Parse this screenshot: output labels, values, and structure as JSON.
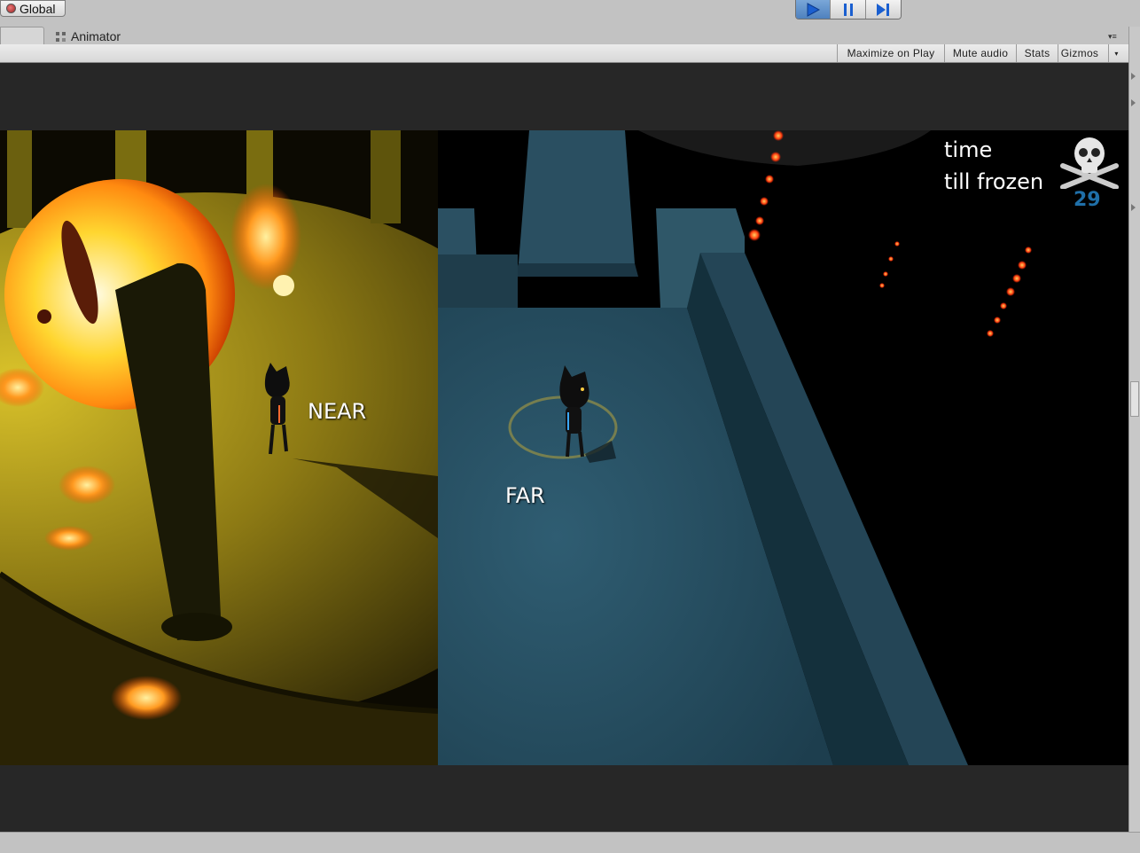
{
  "toolbar": {
    "global_label": "Global",
    "play_button_icon": "play-icon",
    "pause_button_icon": "pause-icon",
    "step_button_icon": "step-icon"
  },
  "tabs": {
    "animator_label": "Animator",
    "animator_icon": "animator-icon"
  },
  "game_view_toolbar": {
    "maximize_on_play": "Maximize on Play",
    "mute_audio": "Mute audio",
    "stats": "Stats",
    "gizmos": "Gizmos"
  },
  "game_hud": {
    "timer_label_line1": "time",
    "timer_label_line2": "till frozen",
    "timer_value": "29",
    "timer_icon": "skull-crossbones-icon",
    "near_label": "NEAR",
    "far_label": "FAR"
  },
  "colors": {
    "play_active": "#4c7fbd",
    "timer_value_color": "#1f6fa8",
    "near_scene_tint": "#c9b020",
    "far_scene_tint": "#244a5c"
  }
}
